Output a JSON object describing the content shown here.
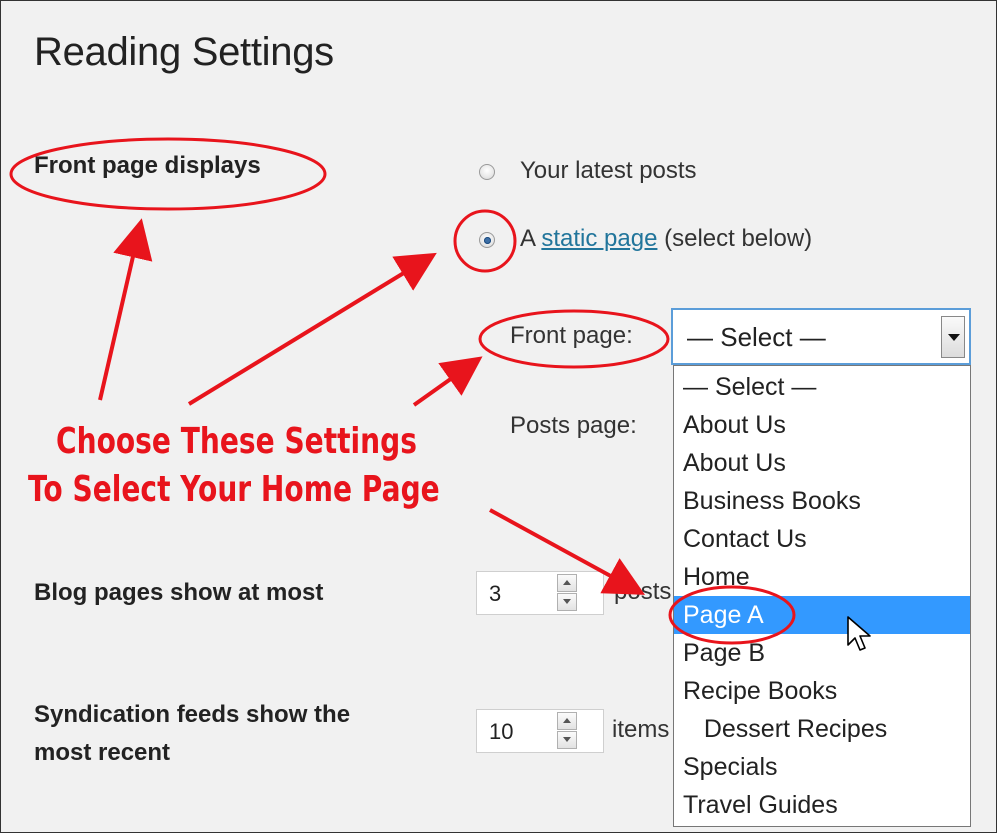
{
  "page": {
    "title": "Reading Settings"
  },
  "front_page_displays": {
    "label": "Front page displays",
    "options": [
      {
        "label": "Your latest posts",
        "checked": false
      },
      {
        "prefix": "A ",
        "link": "static page",
        "suffix": " (select below)",
        "checked": true
      }
    ]
  },
  "front_page_select": {
    "label": "Front page:",
    "value": "— Select —",
    "options": [
      "— Select —",
      "About Us",
      "About Us",
      "Business Books",
      "Contact Us",
      "Home",
      "Page A",
      "Page B",
      "Recipe Books",
      "   Dessert Recipes",
      "Specials",
      "Travel Guides"
    ],
    "highlighted_index": 6
  },
  "posts_page": {
    "label": "Posts page:"
  },
  "blog_pages": {
    "label": "Blog pages show at most",
    "value": "3",
    "suffix": "posts"
  },
  "syndication": {
    "label_line1": "Syndication feeds show the",
    "label_line2": "most recent",
    "value": "10",
    "suffix": "items"
  },
  "annotation": {
    "line1": "Choose These Settings",
    "line2": "To Select Your Home Page",
    "color": "#e8141c"
  },
  "colors": {
    "link": "#21759b",
    "highlight": "#3399ff",
    "select_border": "#5b9dd9"
  }
}
